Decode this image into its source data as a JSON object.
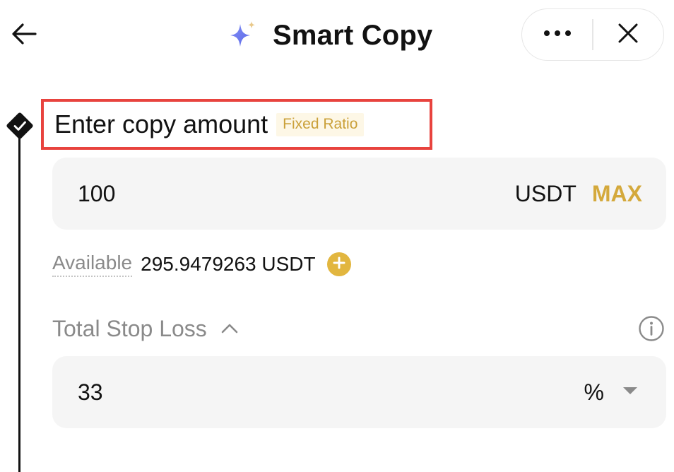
{
  "header": {
    "title": "Smart Copy",
    "back_icon": "arrow-left-icon",
    "logo_icon": "sparkle-icon",
    "more_icon": "more-horizontal-icon",
    "close_icon": "close-icon"
  },
  "copy_amount": {
    "heading": "Enter copy amount",
    "mode_badge": "Fixed Ratio",
    "value": "100",
    "unit": "USDT",
    "max_label": "MAX",
    "available_label": "Available",
    "available_value": "295.9479263 USDT"
  },
  "stop_loss": {
    "label": "Total Stop Loss",
    "value": "33",
    "unit": "%"
  },
  "colors": {
    "accent_gold": "#d4a93c",
    "highlight_red": "#e8433e",
    "badge_bg": "#fdf7e6",
    "field_bg": "#f5f5f5",
    "sparkle_blue": "#6b7bf0"
  }
}
